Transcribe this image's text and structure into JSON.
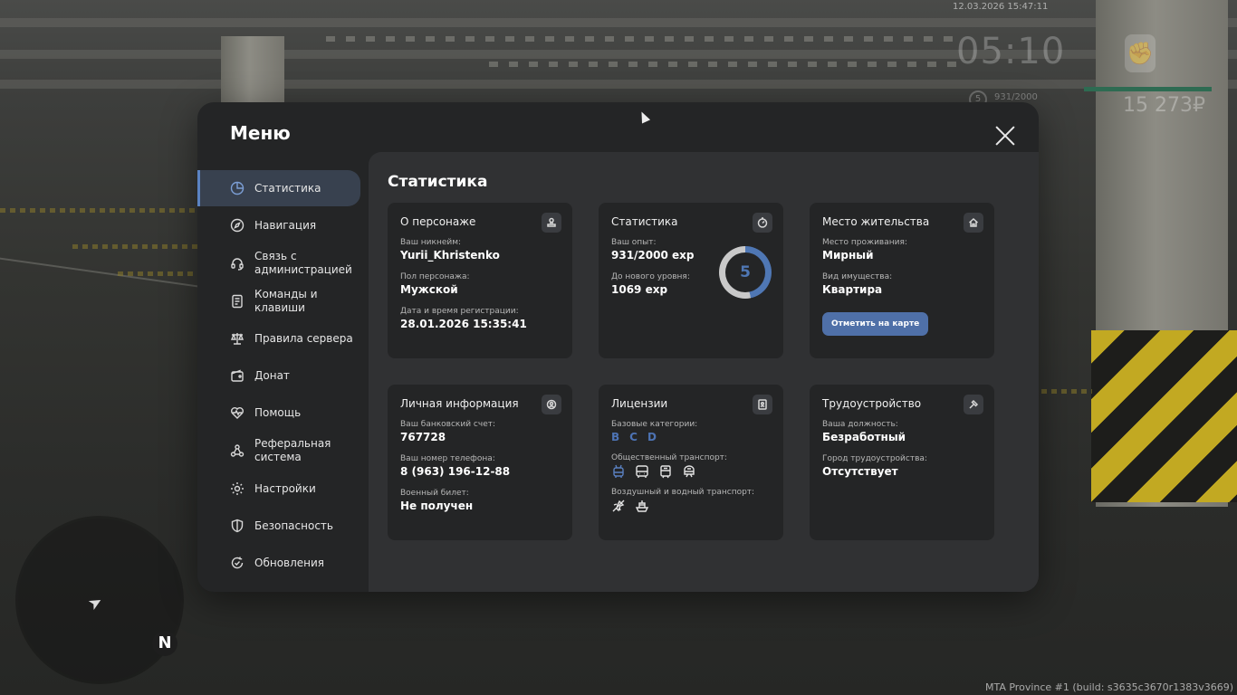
{
  "hud": {
    "datetime": "12.03.2026 15:47:11",
    "clock": "05:10",
    "level": "5",
    "exp": "931/2000",
    "money": "15 273₽",
    "build": "MTA Province #1 (build: s3635c3670r1383v3669)",
    "compass": "N",
    "accent_color": "#2e6b52"
  },
  "menu": {
    "title": "Меню",
    "accent": "#5b83c2"
  },
  "sidebar": {
    "items": [
      {
        "label": "Статистика",
        "icon": "pie-chart-icon",
        "active": true
      },
      {
        "label": "Навигация",
        "icon": "compass-icon"
      },
      {
        "label": "Связь с администрацией",
        "icon": "headset-icon"
      },
      {
        "label": "Команды и клавиши",
        "icon": "document-icon"
      },
      {
        "label": "Правила сервера",
        "icon": "scales-icon"
      },
      {
        "label": "Донат",
        "icon": "wallet-icon"
      },
      {
        "label": "Помощь",
        "icon": "heart-icon"
      },
      {
        "label": "Реферальная система",
        "icon": "network-icon"
      },
      {
        "label": "Настройки",
        "icon": "gear-icon"
      },
      {
        "label": "Безопасность",
        "icon": "shield-icon"
      },
      {
        "label": "Обновления",
        "icon": "refresh-check-icon"
      }
    ]
  },
  "content": {
    "title": "Статистика",
    "character": {
      "title": "О персонаже",
      "nickname_label": "Ваш никнейм:",
      "nickname": "Yurii_Khristenko",
      "gender_label": "Пол персонажа:",
      "gender": "Мужской",
      "reg_label": "Дата и время регистрации:",
      "reg": "28.01.2026 15:35:41"
    },
    "stats": {
      "title": "Статистика",
      "exp_label": "Ваш опыт:",
      "exp": "931/2000 exp",
      "next_label": "До нового уровня:",
      "next": "1069 exp",
      "level": "5",
      "progress": 0.4655
    },
    "residence": {
      "title": "Место жительства",
      "place_label": "Место проживания:",
      "place": "Мирный",
      "property_label": "Вид имущества:",
      "property": "Квартира",
      "button": "Отметить на карте"
    },
    "personal": {
      "title": "Личная информация",
      "bank_label": "Ваш банковский счет:",
      "bank": "767728",
      "phone_label": "Ваш номер телефона:",
      "phone": "8 (963) 196-12-88",
      "military_label": "Военный билет:",
      "military": "Не получен"
    },
    "licenses": {
      "title": "Лицензии",
      "basic_label": "Базовые категории:",
      "categories": [
        "B",
        "C",
        "D"
      ],
      "public_label": "Общественный транспорт:",
      "air_label": "Воздушный и водный транспорт:"
    },
    "employment": {
      "title": "Трудоустройство",
      "position_label": "Ваша должность:",
      "position": "Безработный",
      "city_label": "Город трудоустройства:",
      "city": "Отсутствует"
    }
  }
}
